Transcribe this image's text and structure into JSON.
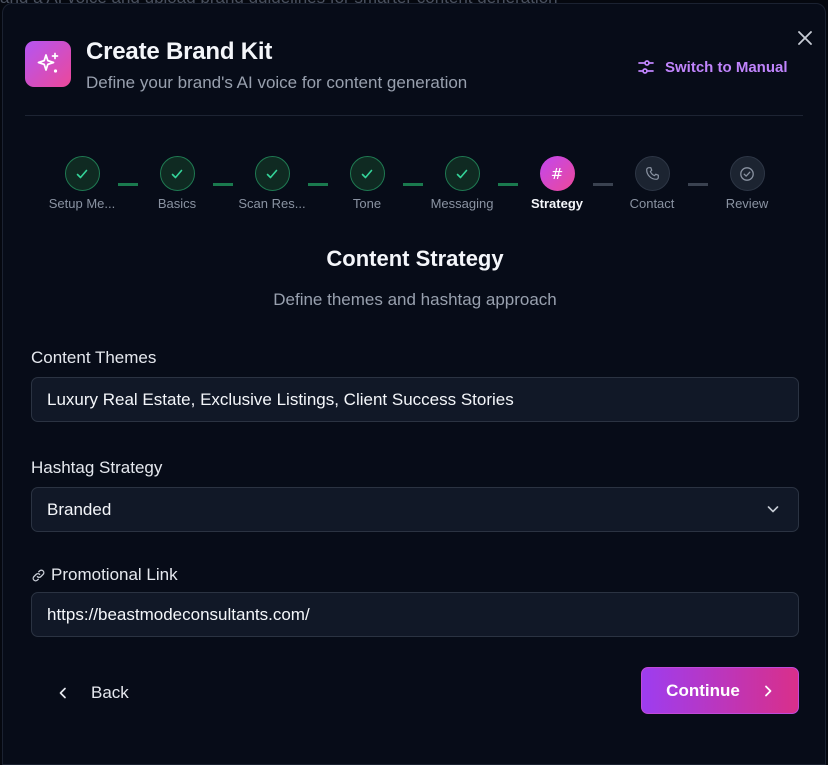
{
  "backdrop": {
    "text": "and a AI voice and upload brand guidelines for smarter content generation"
  },
  "header": {
    "title": "Create Brand Kit",
    "subtitle": "Define your brand's AI voice for content generation",
    "switch_label": "Switch to Manual"
  },
  "stepper": {
    "steps": [
      {
        "label": "Setup Me...",
        "state": "done"
      },
      {
        "label": "Basics",
        "state": "done"
      },
      {
        "label": "Scan Res...",
        "state": "done"
      },
      {
        "label": "Tone",
        "state": "done"
      },
      {
        "label": "Messaging",
        "state": "done"
      },
      {
        "label": "Strategy",
        "state": "active",
        "glyph": "#"
      },
      {
        "label": "Contact",
        "state": "pending"
      },
      {
        "label": "Review",
        "state": "pending"
      }
    ]
  },
  "section": {
    "title": "Content Strategy",
    "subtitle": "Define themes and hashtag approach"
  },
  "fields": {
    "themes_label": "Content Themes",
    "themes_value": "Luxury Real Estate, Exclusive Listings, Client Success Stories",
    "hashtag_label": "Hashtag Strategy",
    "hashtag_value": "Branded",
    "promo_label": "Promotional Link",
    "promo_value": "https://beastmodeconsultants.com/"
  },
  "footer": {
    "back_label": "Back",
    "continue_label": "Continue"
  },
  "colors": {
    "accent_purple": "#c084fc",
    "gradient_start": "#9d3df0",
    "gradient_end": "#d92f8a",
    "done_green": "#1f7a52"
  }
}
